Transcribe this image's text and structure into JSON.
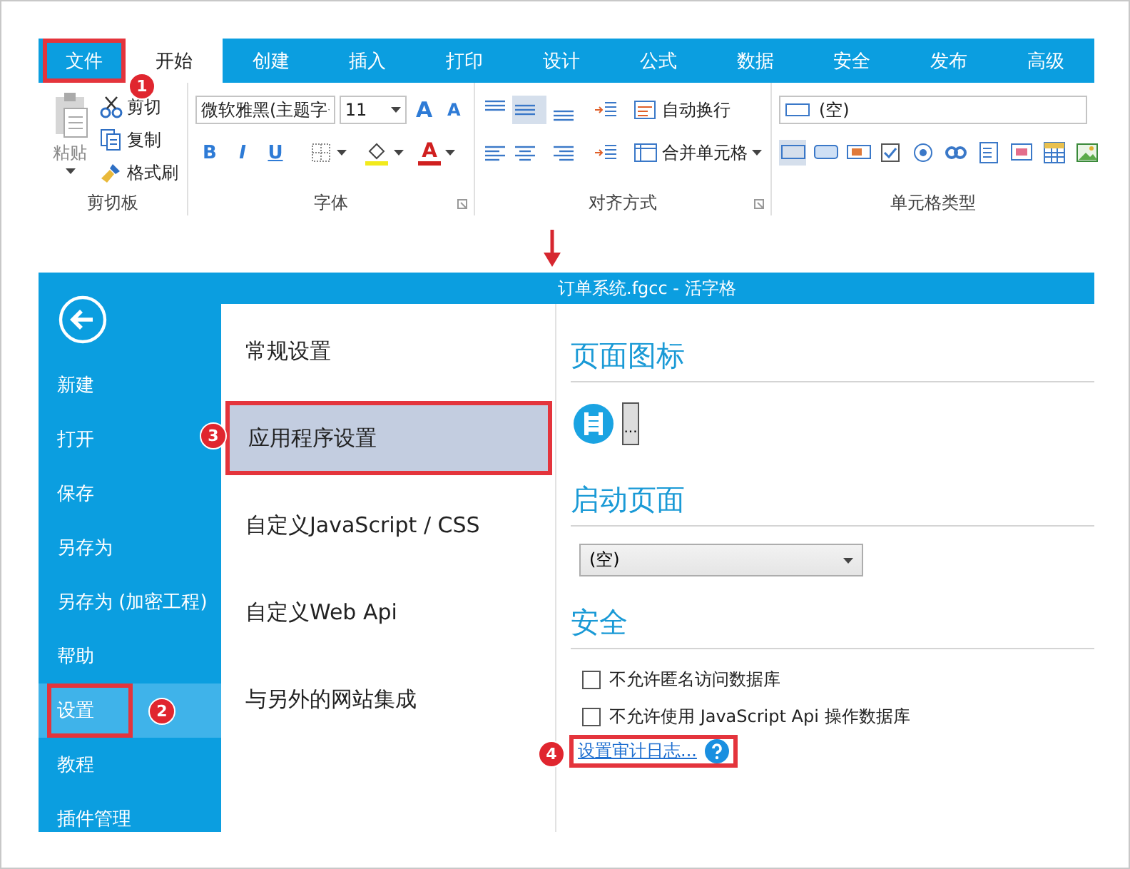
{
  "ribbon": {
    "tabs": [
      {
        "label": "文件",
        "selected": false,
        "highlighted": true,
        "badge": "1"
      },
      {
        "label": "开始",
        "selected": true,
        "highlighted": false
      },
      {
        "label": "创建",
        "selected": false,
        "highlighted": false
      },
      {
        "label": "插入",
        "selected": false,
        "highlighted": false
      },
      {
        "label": "打印",
        "selected": false,
        "highlighted": false
      },
      {
        "label": "设计",
        "selected": false,
        "highlighted": false
      },
      {
        "label": "公式",
        "selected": false,
        "highlighted": false
      },
      {
        "label": "数据",
        "selected": false,
        "highlighted": false
      },
      {
        "label": "安全",
        "selected": false,
        "highlighted": false
      },
      {
        "label": "发布",
        "selected": false,
        "highlighted": false
      },
      {
        "label": "高级",
        "selected": false,
        "highlighted": false
      }
    ],
    "clipboard": {
      "paste": "粘贴",
      "cut": "剪切",
      "copy": "复制",
      "format_painter": "格式刷",
      "label": "剪切板"
    },
    "font": {
      "font_name": "微软雅黑(主题字",
      "font_size": "11",
      "grow": "A",
      "shrink": "A",
      "bold": "B",
      "italic": "I",
      "underline": "U",
      "font_color": "A",
      "label": "字体"
    },
    "alignment": {
      "wrap_text": "自动换行",
      "merge_cells": "合并单元格",
      "label": "对齐方式"
    },
    "cell_type": {
      "value": "(空)",
      "label": "单元格类型"
    }
  },
  "backstage": {
    "title": "订单系统.fgcc - 活字格",
    "menu": [
      {
        "label": "新建",
        "selected": false,
        "highlighted": false
      },
      {
        "label": "打开",
        "selected": false,
        "highlighted": false
      },
      {
        "label": "保存",
        "selected": false,
        "highlighted": false
      },
      {
        "label": "另存为",
        "selected": false,
        "highlighted": false
      },
      {
        "label": "另存为 (加密工程)",
        "selected": false,
        "highlighted": false
      },
      {
        "label": "帮助",
        "selected": false,
        "highlighted": false
      },
      {
        "label": "设置",
        "selected": true,
        "highlighted": true,
        "badge": "2"
      },
      {
        "label": "教程",
        "selected": false,
        "highlighted": false
      },
      {
        "label": "插件管理",
        "selected": false,
        "highlighted": false
      }
    ],
    "settings_nav": [
      {
        "label": "常规设置",
        "selected": false,
        "highlighted": false
      },
      {
        "label": "应用程序设置",
        "selected": true,
        "highlighted": true,
        "badge": "3"
      },
      {
        "label": "自定义JavaScript / CSS",
        "selected": false,
        "highlighted": false
      },
      {
        "label": "自定义Web Api",
        "selected": false,
        "highlighted": false
      },
      {
        "label": "与另外的网站集成",
        "selected": false,
        "highlighted": false
      }
    ],
    "page_icon": {
      "heading": "页面图标",
      "browse_button": "..."
    },
    "start_page": {
      "heading": "启动页面",
      "value": "(空)"
    },
    "security": {
      "heading": "安全",
      "options": [
        {
          "label": "不允许匿名访问数据库",
          "checked": false
        },
        {
          "label": "不允许使用 JavaScript Api 操作数据库",
          "checked": false
        }
      ],
      "audit_link": {
        "label": "设置审计日志...",
        "highlighted": true,
        "badge": "4"
      }
    }
  }
}
